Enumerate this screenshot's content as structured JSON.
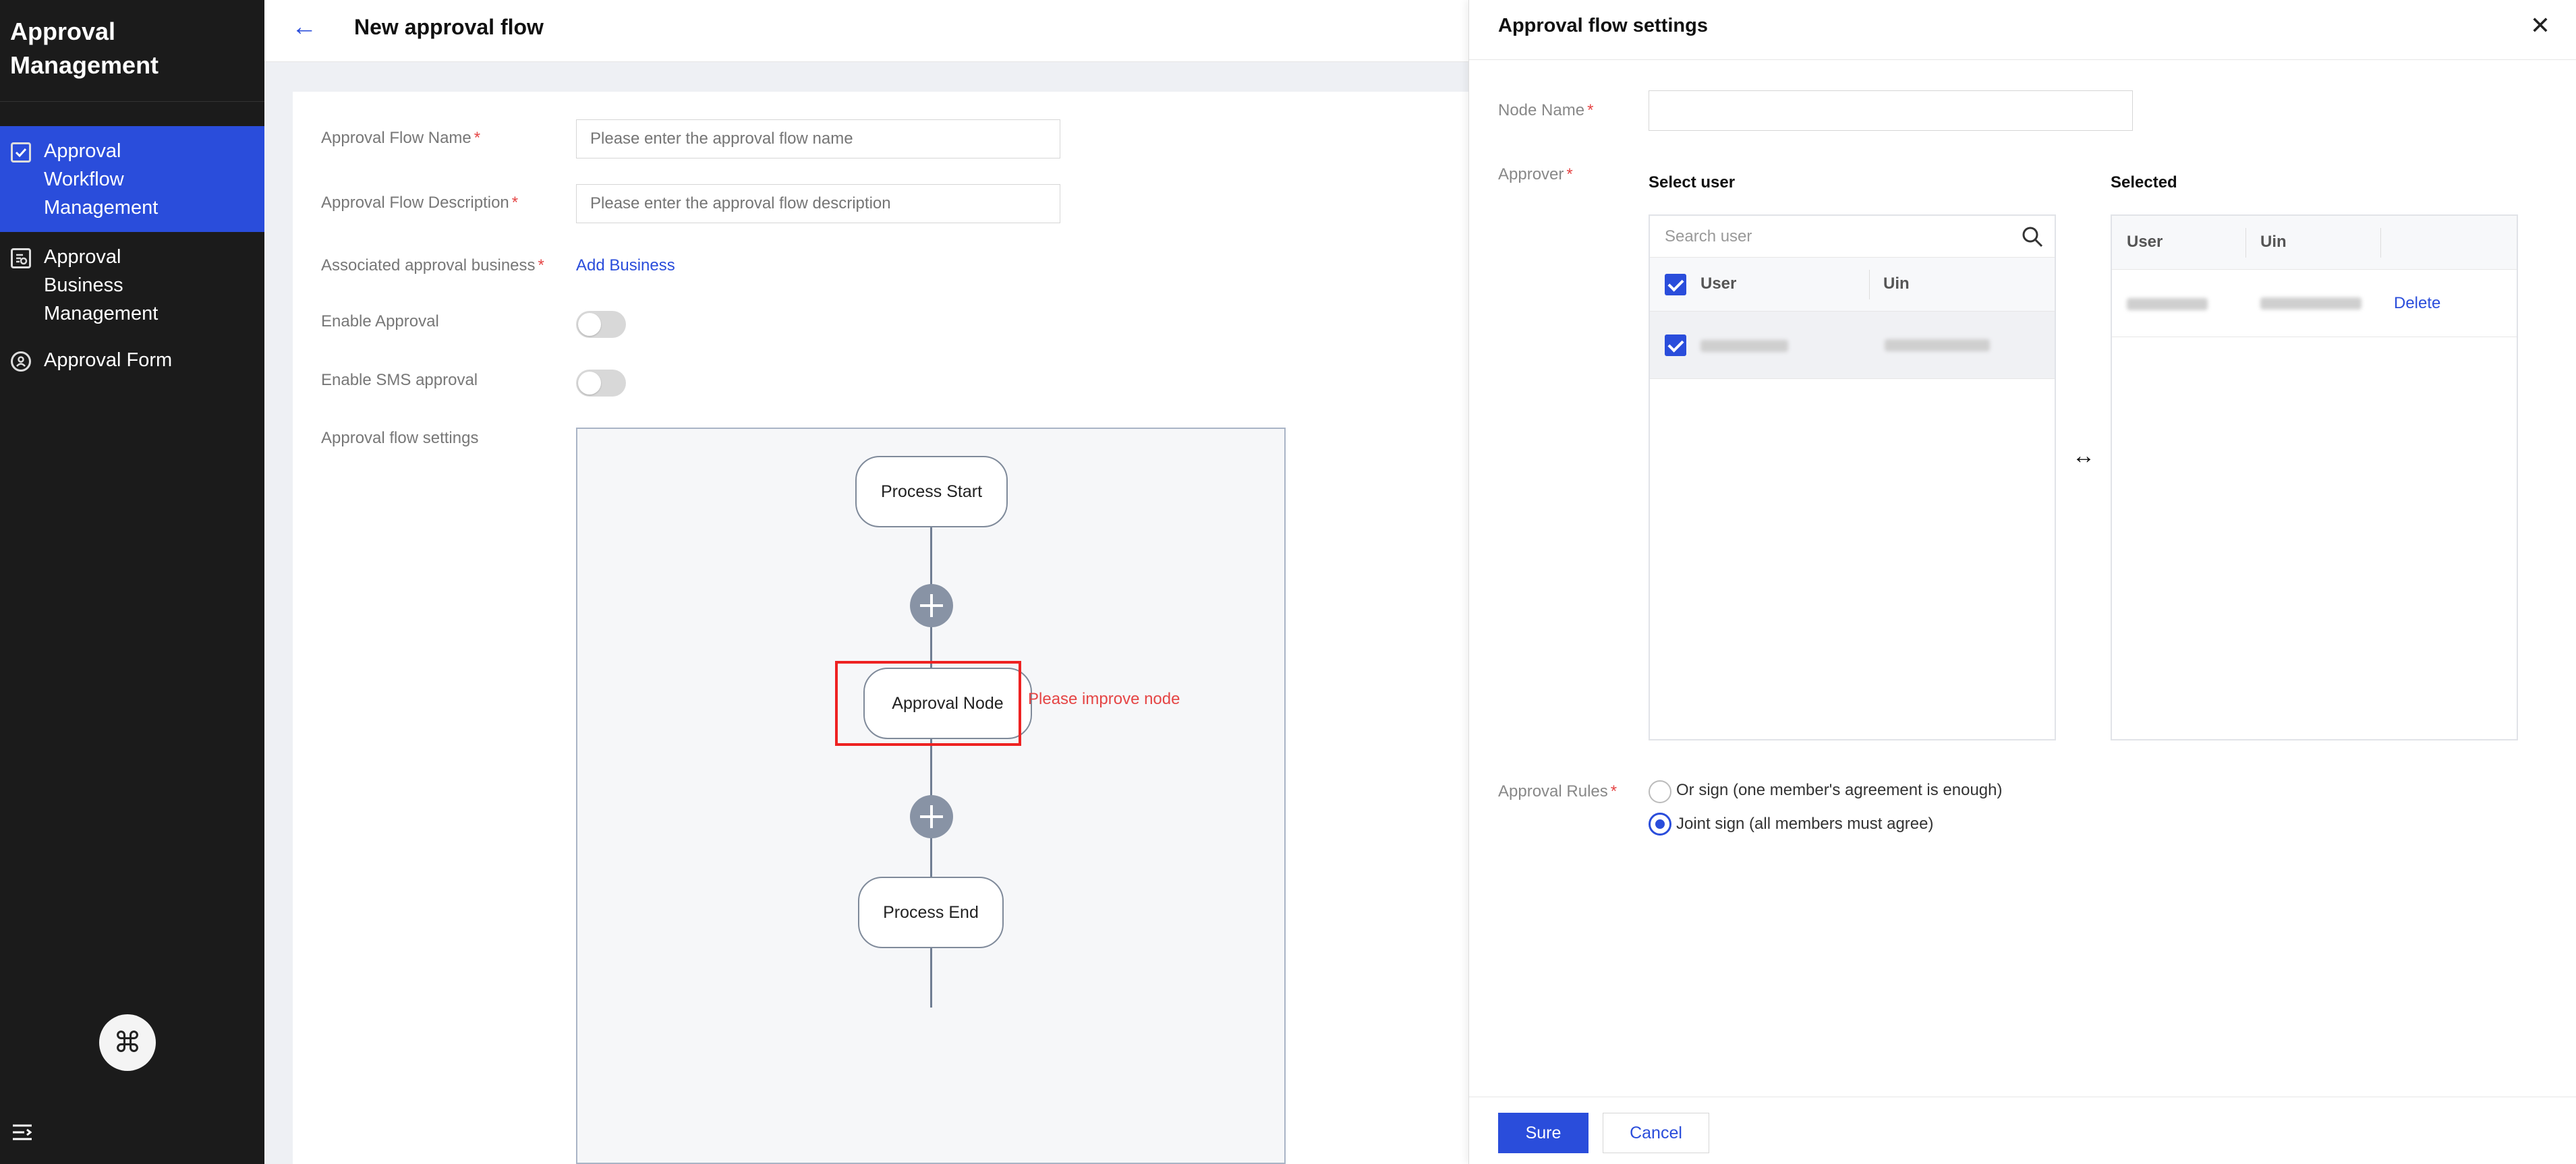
{
  "sidebar": {
    "brand": "Approval Management",
    "items": [
      {
        "label": "Approval Workflow Management",
        "icon": "checkbox-icon",
        "active": true
      },
      {
        "label": "Approval Business Management",
        "icon": "document-search-icon",
        "active": false
      },
      {
        "label": "Approval Form",
        "icon": "user-circle-icon",
        "active": false
      }
    ],
    "cmd_symbol": "⌘"
  },
  "header": {
    "back_symbol": "←",
    "title": "New approval flow"
  },
  "form": {
    "flow_name_label": "Approval Flow Name",
    "flow_name_placeholder": "Please enter the approval flow name",
    "flow_desc_label": "Approval Flow Description",
    "flow_desc_placeholder": "Please enter the approval flow description",
    "business_label": "Associated approval business",
    "add_business": "Add Business",
    "enable_approval_label": "Enable Approval",
    "enable_sms_label": "Enable SMS approval",
    "flow_settings_label": "Approval flow settings",
    "required_mark": "*"
  },
  "flow": {
    "start": "Process Start",
    "node": "Approval Node",
    "end": "Process End",
    "error": "Please improve node"
  },
  "drawer": {
    "title": "Approval flow settings",
    "close_symbol": "✕",
    "node_name_label": "Node Name",
    "approver_label": "Approver",
    "select_user_title": "Select user",
    "selected_title": "Selected",
    "search_placeholder": "Search user",
    "col_user": "User",
    "col_uin": "Uin",
    "delete": "Delete",
    "transfer_symbol": "↔",
    "rules_label": "Approval Rules",
    "rule_or": "Or sign (one member's agreement is enough)",
    "rule_joint": "Joint sign (all members must agree)",
    "sure": "Sure",
    "cancel": "Cancel"
  },
  "colors": {
    "accent": "#2a4ddb",
    "sidebar_bg": "#1b1b1b",
    "error": "#e22222"
  }
}
